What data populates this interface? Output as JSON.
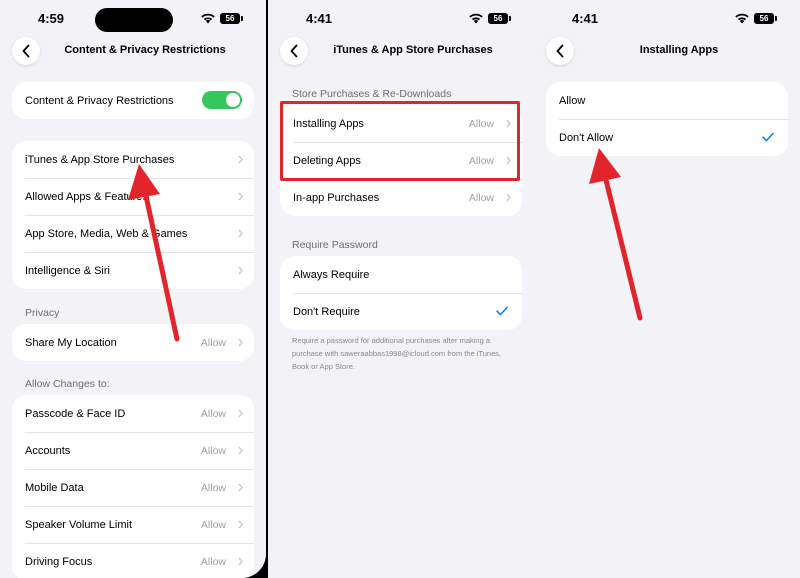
{
  "accent_color": "#007aff",
  "toggle_color": "#34c759",
  "annotation_color": "#e3242b",
  "screen1": {
    "time": "4:59",
    "battery": "56",
    "title": "Content & Privacy Restrictions",
    "toggle_row": {
      "label": "Content & Privacy Restrictions",
      "state": "on"
    },
    "group_main": [
      {
        "label": "iTunes & App Store Purchases"
      },
      {
        "label": "Allowed Apps & Features"
      },
      {
        "label": "App Store, Media, Web & Games"
      },
      {
        "label": "Intelligence & Siri"
      }
    ],
    "privacy_header": "Privacy",
    "privacy_rows": [
      {
        "label": "Share My Location",
        "value": "Allow"
      }
    ],
    "allow_changes_header": "Allow Changes to:",
    "allow_changes_rows": [
      {
        "label": "Passcode & Face ID",
        "value": "Allow"
      },
      {
        "label": "Accounts",
        "value": "Allow"
      },
      {
        "label": "Mobile Data",
        "value": "Allow"
      },
      {
        "label": "Speaker Volume Limit",
        "value": "Allow"
      },
      {
        "label": "Driving Focus",
        "value": "Allow"
      }
    ]
  },
  "screen2": {
    "time": "4:41",
    "battery": "56",
    "title": "iTunes & App Store Purchases",
    "store_header": "Store Purchases & Re-Downloads",
    "store_rows": [
      {
        "label": "Installing Apps",
        "value": "Allow"
      },
      {
        "label": "Deleting Apps",
        "value": "Allow"
      },
      {
        "label": "In-app Purchases",
        "value": "Allow"
      }
    ],
    "password_header": "Require Password",
    "password_rows": [
      {
        "label": "Always Require"
      },
      {
        "label": "Don't Require",
        "selected": true
      }
    ],
    "footnote": "Require a password for additional purchases after making a purchase with saweraabbas1998@icloud.com from the iTunes, Book or App Store."
  },
  "screen3": {
    "time": "4:41",
    "battery": "56",
    "title": "Installing Apps",
    "options": [
      {
        "label": "Allow"
      },
      {
        "label": "Don't Allow",
        "selected": true
      }
    ]
  }
}
